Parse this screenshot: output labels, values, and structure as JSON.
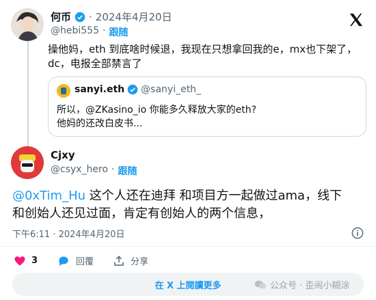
{
  "tweet1": {
    "name": "何币",
    "date": "2024年4月20日",
    "handle": "@hebi555",
    "follow": "跟随",
    "dot": "·",
    "text_line1": "操他妈，eth 到底啥时候退，我现在只想拿回我的e，mx也下架了，",
    "text_line2": "dc，电报全部禁言了"
  },
  "quote": {
    "name": "sanyi.eth",
    "handle": "@sanyi_eth_",
    "text_line1": "所以，@ZKasino_io 你能多久释放大家的eth?",
    "text_line2": "他妈的还改白皮书..."
  },
  "tweet2": {
    "name": "Cjxy",
    "handle": "@csyx_hero",
    "dot": "·",
    "follow": "跟随",
    "mention": "@0xTim_Hu",
    "text_after_mention": " 这个人还在迪拜 和项目方一起做过ama，线下",
    "text_line2": "和创始人还见过面，肯定有创始人的两个信息，",
    "timestamp": "下午6:11 · 2024年4月20日"
  },
  "actions": {
    "like_count": "3",
    "reply_label": "回覆",
    "share_label": "分享"
  },
  "footer": {
    "more_label": "在 X 上閱讀更多",
    "watermark": "公众号 · 歪闹小糊涂"
  },
  "colors": {
    "accent": "#1d9bf0",
    "like": "#f91880",
    "muted": "#536471"
  }
}
